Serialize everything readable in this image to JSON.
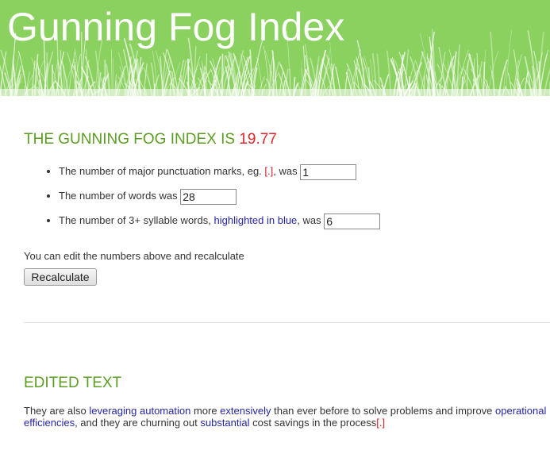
{
  "header": {
    "title": "Gunning Fog Index"
  },
  "result": {
    "label": "THE GUNNING FOG INDEX IS",
    "score": "19.77"
  },
  "stats": {
    "punctuation": {
      "text_before": "The number of major punctuation marks, eg.",
      "example": "[.]",
      "text_after": ", was",
      "value": "1"
    },
    "words": {
      "text": "The number of words was",
      "value": "28"
    },
    "syllables": {
      "text_before": "The number of 3+ syllable words,",
      "highlight": "highlighted in blue",
      "text_after": ", was",
      "value": "6"
    }
  },
  "edit_note": "You can edit the numbers above and recalculate",
  "recalculate_label": "Recalculate",
  "edited": {
    "heading": "EDITED TEXT",
    "segments": [
      {
        "text": "They are also ",
        "type": "plain"
      },
      {
        "text": "leveraging",
        "type": "complex"
      },
      {
        "text": " ",
        "type": "plain"
      },
      {
        "text": "automation",
        "type": "complex"
      },
      {
        "text": " more ",
        "type": "plain"
      },
      {
        "text": "extensively",
        "type": "complex"
      },
      {
        "text": " than ever before to solve problems and improve ",
        "type": "plain"
      },
      {
        "text": "operational",
        "type": "complex"
      },
      {
        "text": " ",
        "type": "plain"
      },
      {
        "text": "efficiencies",
        "type": "complex"
      },
      {
        "text": ", and they are churning out ",
        "type": "plain"
      },
      {
        "text": "substantial",
        "type": "complex"
      },
      {
        "text": " cost savings in the process",
        "type": "plain"
      },
      {
        "text": "[.]",
        "type": "punct"
      }
    ]
  },
  "colors": {
    "header_bg": "#8bd160",
    "heading": "#5c9d23",
    "score": "#e0262b",
    "highlight": "#2525a8",
    "punct": "#c8202a"
  }
}
